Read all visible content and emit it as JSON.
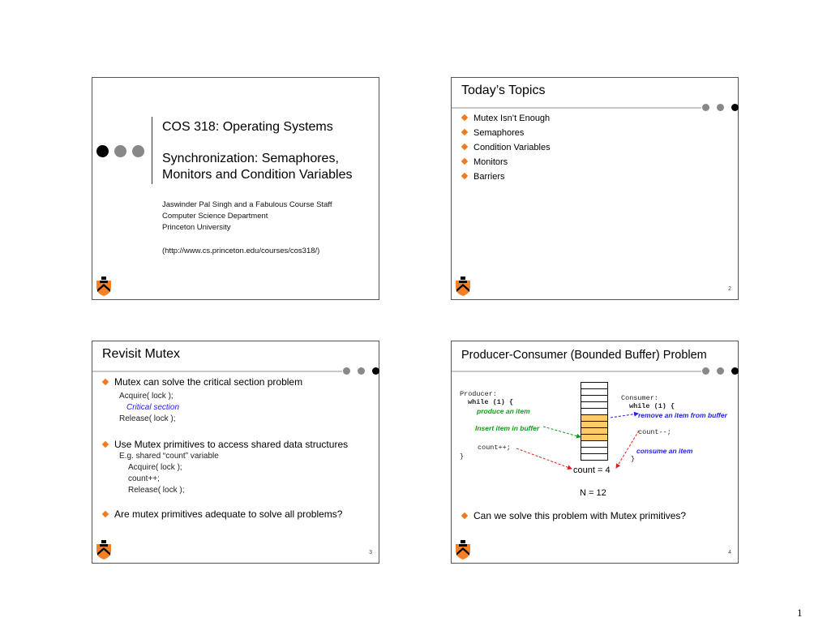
{
  "page_number": "1",
  "slides": [
    {
      "number": "",
      "title_line1": "COS 318: Operating Systems",
      "title_line2": "Synchronization: Semaphores,",
      "title_line3": "Monitors and Condition Variables",
      "authors": "Jaswinder Pal Singh and a Fabulous Course  Staff",
      "department": "Computer Science Department",
      "university": "Princeton University",
      "url": "(http://www.cs.princeton.edu/courses/cos318/)"
    },
    {
      "number": "2",
      "title": "Today’s Topics",
      "bullets": [
        "Mutex Isn’t Enough",
        "Semaphores",
        "Condition Variables",
        "Monitors",
        "Barriers"
      ]
    },
    {
      "number": "3",
      "title": "Revisit Mutex",
      "bullet1": "Mutex can solve the critical section problem",
      "code1": [
        "Acquire( lock );",
        "Critical section",
        "Release( lock );"
      ],
      "bullet2": "Use Mutex primitives to access shared data structures",
      "code2_intro": "E.g. shared “count” variable",
      "code2": [
        "Acquire( lock );",
        "count++;",
        "Release( lock );"
      ],
      "bullet3": "Are mutex primitives adequate to solve all problems?"
    },
    {
      "number": "4",
      "title": "Producer-Consumer (Bounded Buffer) Problem",
      "producer": {
        "label": "Producer:",
        "loop": "while (1) {",
        "produce": "produce an item",
        "insert": "Insert item in buffer",
        "count": "count++;",
        "close": "}"
      },
      "consumer": {
        "label": "Consumer:",
        "loop": "while (1) {",
        "remove": "remove an item from buffer",
        "count": "count--;",
        "consume": "consume an item",
        "close": "}"
      },
      "buffer": {
        "size": 12,
        "filled_start": 5,
        "filled_count": 4,
        "fill_color": "#ffcc66"
      },
      "count_label": "count = 4",
      "n_label": "N = 12",
      "bullet": "Can we solve this problem with Mutex primitives?"
    }
  ],
  "colors": {
    "bullet": "#f07a1e",
    "code_blue": "#2222ee",
    "code_green": "#139c13",
    "arrow_red": "#e02020"
  }
}
